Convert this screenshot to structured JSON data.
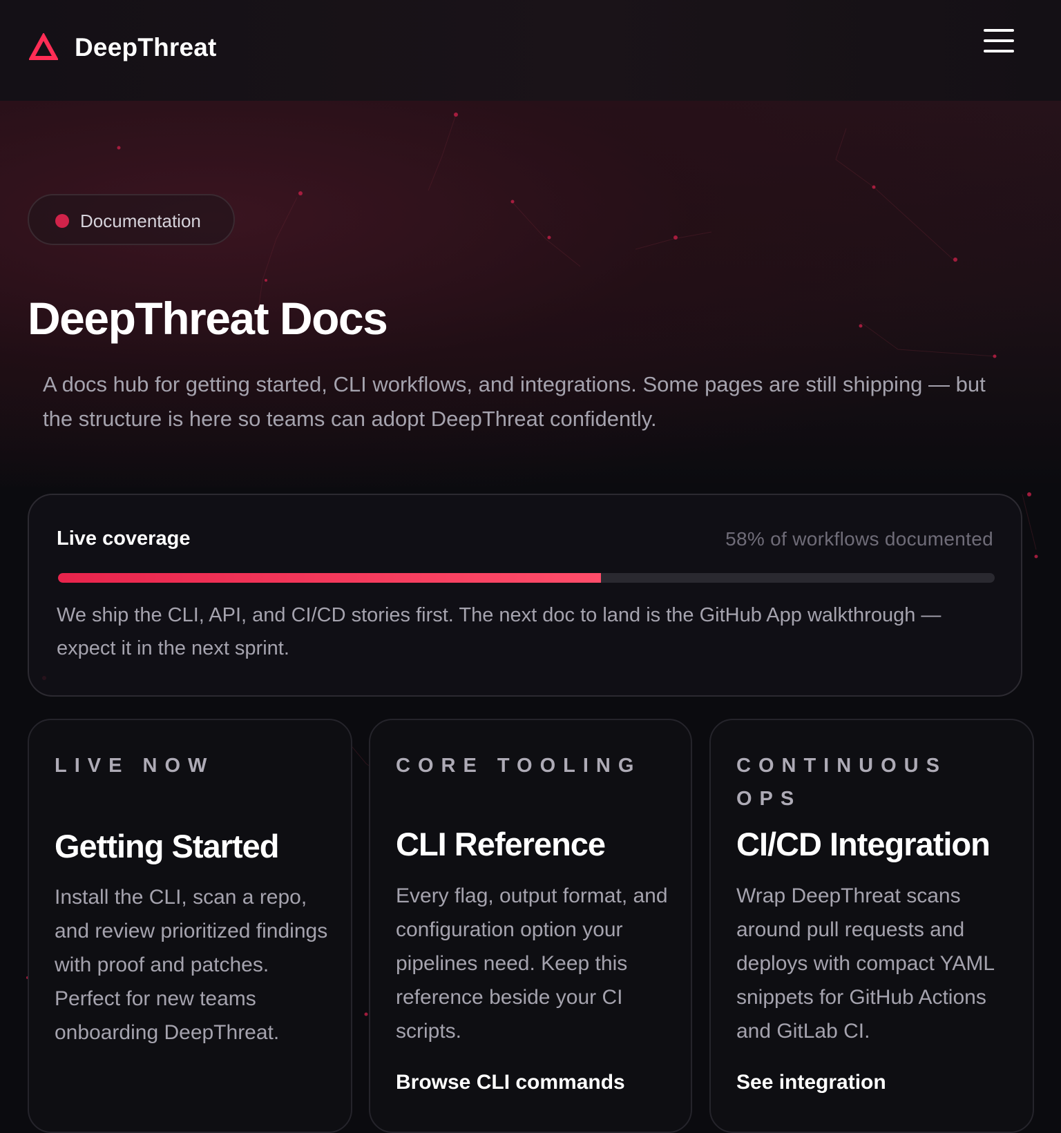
{
  "header": {
    "brand_name": "DeepThreat",
    "brand_color": "#ff2d55",
    "menu_icon": "hamburger-menu-icon"
  },
  "hero": {
    "badge_label": "Documentation",
    "badge_dot_color": "#d1234a",
    "title": "DeepThreat Docs",
    "intro": "A docs hub for getting started, CLI workflows, and integrations. Some pages are still shipping — but the structure is here so teams can adopt DeepThreat confidently."
  },
  "coverage": {
    "title": "Live coverage",
    "stat": "58% of workflows documented",
    "progress_fraction": 0.58,
    "accent_color": "#ff3b5c",
    "description": "We ship the CLI, API, and CI/CD stories first. The next doc to land is the GitHub App walkthrough — expect it in the next sprint."
  },
  "cards": [
    {
      "eyebrow": "LIVE NOW",
      "title": "Getting Started",
      "description": "Install the CLI, scan a repo, and review prioritized findings with proof and patches. Perfect for new teams onboarding DeepThreat.",
      "link_label": ""
    },
    {
      "eyebrow": "CORE TOOLING",
      "title": "CLI Reference",
      "description": "Every flag, output format, and configuration option your pipelines need. Keep this reference beside your CI scripts.",
      "link_label": "Browse CLI commands"
    },
    {
      "eyebrow": "CONTINUOUS OPS",
      "title": "CI/CD Integration",
      "description": "Wrap DeepThreat scans around pull requests and deploys with compact YAML snippets for GitHub Actions and GitLab CI.",
      "link_label": "See integration"
    }
  ]
}
